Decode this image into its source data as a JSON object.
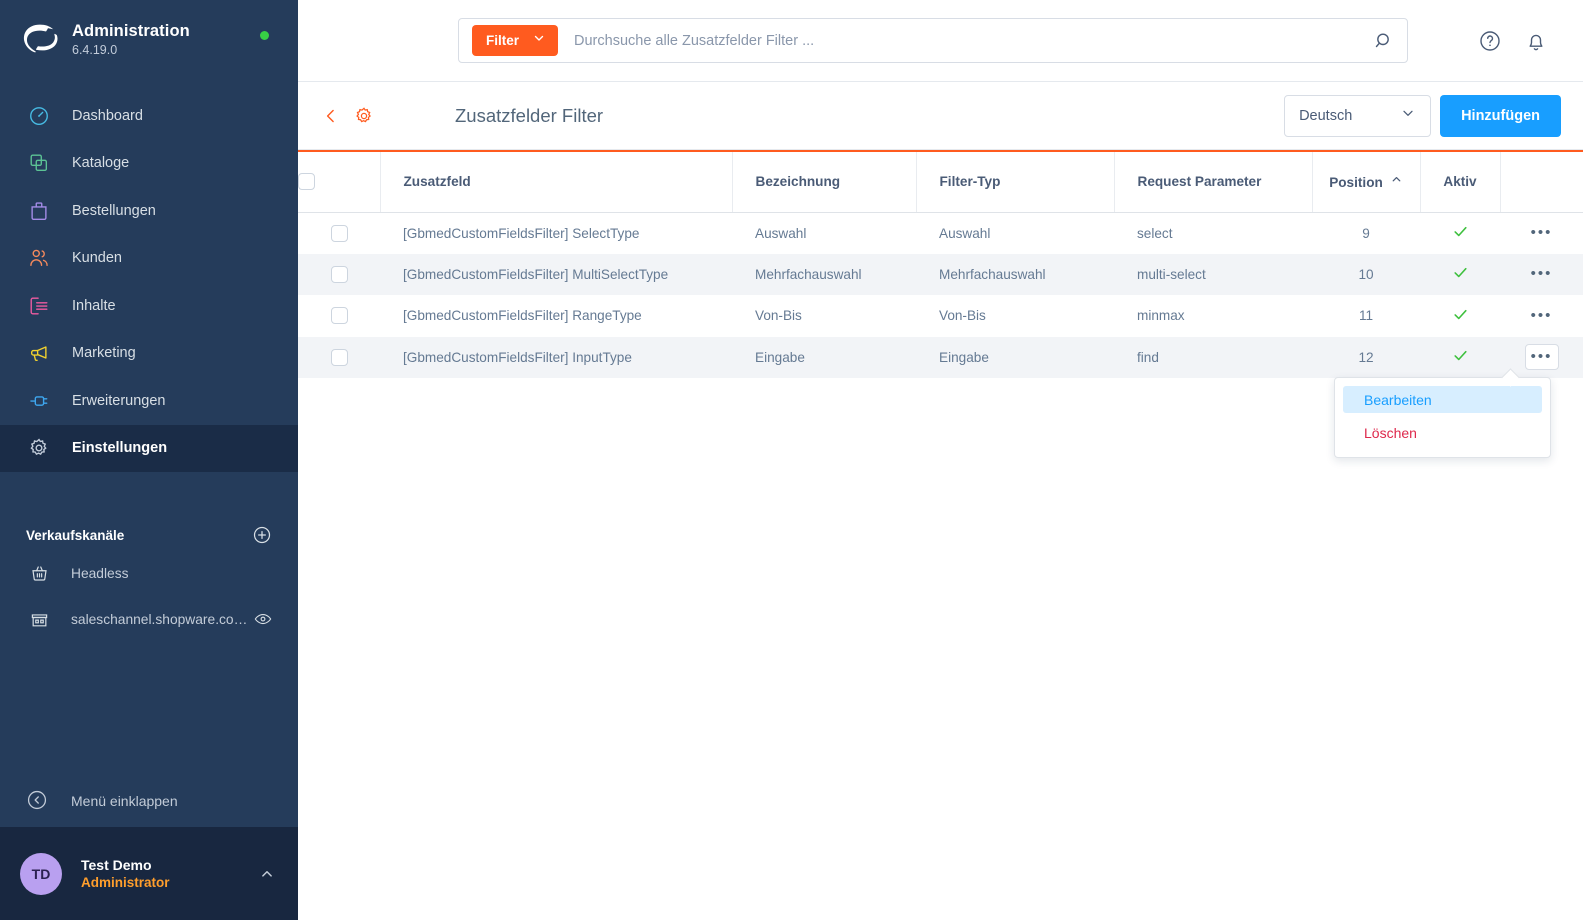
{
  "sidebar": {
    "brand": {
      "title": "Administration",
      "version": "6.4.19.0",
      "logo_icon": "shopware-logo-icon",
      "status_icon": "status-dot-online"
    },
    "items": [
      {
        "label": "Dashboard",
        "icon": "dashboard-icon",
        "color": "#47bbe3"
      },
      {
        "label": "Kataloge",
        "icon": "catalog-icon",
        "color": "#5cc395"
      },
      {
        "label": "Bestellungen",
        "icon": "orders-bag-icon",
        "color": "#a48ce8"
      },
      {
        "label": "Kunden",
        "icon": "customers-icon",
        "color": "#f58a5c"
      },
      {
        "label": "Inhalte",
        "icon": "content-icon",
        "color": "#ef5ba1"
      },
      {
        "label": "Marketing",
        "icon": "megaphone-icon",
        "color": "#f2d22e"
      },
      {
        "label": "Erweiterungen",
        "icon": "plug-icon",
        "color": "#3ea7f0"
      },
      {
        "label": "Einstellungen",
        "icon": "gear-icon",
        "color": "#c2ccda",
        "active": true
      }
    ],
    "sales_channels": {
      "title": "Verkaufskanäle",
      "add_icon": "plus-circle-icon",
      "channels": [
        {
          "label": "Headless",
          "icon": "basket-icon",
          "has_eye": false
        },
        {
          "label": "saleschannel.shopware.co…",
          "icon": "storefront-icon",
          "has_eye": true,
          "eye_icon": "eye-icon"
        }
      ]
    },
    "collapse": {
      "label": "Menü einklappen",
      "icon": "collapse-left-icon"
    },
    "user": {
      "initials": "TD",
      "name": "Test Demo",
      "role": "Administrator",
      "caret_icon": "chevron-up-icon"
    }
  },
  "topbar": {
    "filter_button": {
      "label": "Filter",
      "icon": "chevron-down-icon"
    },
    "search": {
      "value": "",
      "placeholder": "Durchsuche alle Zusatzfelder Filter ..."
    },
    "search_icon": "search-icon",
    "help_icon": "help-circle-icon",
    "notification_icon": "bell-icon"
  },
  "pagehead": {
    "back_icon": "chevron-left-icon",
    "gear_icon": "gear-icon",
    "title": "Zusatzfelder Filter",
    "language": {
      "value": "Deutsch",
      "icon": "chevron-down-icon"
    },
    "add_label": "Hinzufügen"
  },
  "table": {
    "select_all_checkbox": false,
    "columns": [
      {
        "key": "zusatzfeld",
        "label": "Zusatzfeld"
      },
      {
        "key": "bezeichnung",
        "label": "Bezeichnung"
      },
      {
        "key": "filtertyp",
        "label": "Filter-Typ"
      },
      {
        "key": "request",
        "label": "Request Parameter"
      },
      {
        "key": "position",
        "label": "Position",
        "sorted": "asc",
        "sort_icon": "chevron-up-icon"
      },
      {
        "key": "aktiv",
        "label": "Aktiv"
      }
    ],
    "rows": [
      {
        "zusatzfeld": "[GbmedCustomFieldsFilter] SelectType",
        "bezeichnung": "Auswahl",
        "filtertyp": "Auswahl",
        "request": "select",
        "position": "9",
        "aktiv": true,
        "menu_open": false
      },
      {
        "zusatzfeld": "[GbmedCustomFieldsFilter] MultiSelectType",
        "bezeichnung": "Mehrfachauswahl",
        "filtertyp": "Mehrfachauswahl",
        "request": "multi-select",
        "position": "10",
        "aktiv": true,
        "menu_open": false
      },
      {
        "zusatzfeld": "[GbmedCustomFieldsFilter] RangeType",
        "bezeichnung": "Von-Bis",
        "filtertyp": "Von-Bis",
        "request": "minmax",
        "position": "11",
        "aktiv": true,
        "menu_open": false
      },
      {
        "zusatzfeld": "[GbmedCustomFieldsFilter] InputType",
        "bezeichnung": "Eingabe",
        "filtertyp": "Eingabe",
        "request": "find",
        "position": "12",
        "aktiv": true,
        "menu_open": true
      }
    ],
    "row_menu_icon": "ellipsis-icon",
    "active_icon": "check-icon"
  },
  "context_menu": {
    "edit_label": "Bearbeiten",
    "delete_label": "Löschen"
  },
  "colors": {
    "sidebar_bg": "#253c5b",
    "sidebar_active": "#1a2c47",
    "accent_orange": "#ff5b1f",
    "accent_blue": "#189eff",
    "danger_red": "#de294c",
    "success_green": "#37d045"
  }
}
